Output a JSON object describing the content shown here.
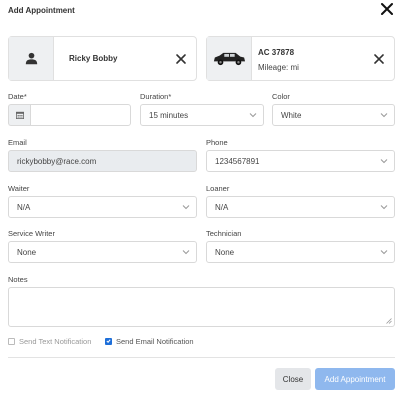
{
  "modal": {
    "title": "Add Appointment"
  },
  "customer": {
    "name": "Ricky Bobby"
  },
  "vehicle": {
    "plate": "AC 37878",
    "mileage": "Mileage: mi"
  },
  "fields": {
    "date": {
      "label": "Date*",
      "value": ""
    },
    "duration": {
      "label": "Duration*",
      "value": "15 minutes"
    },
    "color": {
      "label": "Color",
      "value": "White"
    },
    "email": {
      "label": "Email",
      "value": "rickybobby@race.com"
    },
    "phone": {
      "label": "Phone",
      "value": "1234567891"
    },
    "waiter": {
      "label": "Waiter",
      "value": "N/A"
    },
    "loaner": {
      "label": "Loaner",
      "value": "N/A"
    },
    "service_writer": {
      "label": "Service Writer",
      "value": "None"
    },
    "technician": {
      "label": "Technician",
      "value": "None"
    },
    "notes": {
      "label": "Notes",
      "value": ""
    }
  },
  "notifications": {
    "text": {
      "label": "Send Text Notification",
      "checked": false
    },
    "email": {
      "label": "Send Email Notification",
      "checked": true
    }
  },
  "footer": {
    "close_label": "Close",
    "add_label": "Add Appointment"
  },
  "colors": {
    "primary": "#1e6fd9",
    "primary_disabled": "#8fb8ee",
    "border": "#d9d9d9",
    "readonly_bg": "#e9ecef"
  }
}
